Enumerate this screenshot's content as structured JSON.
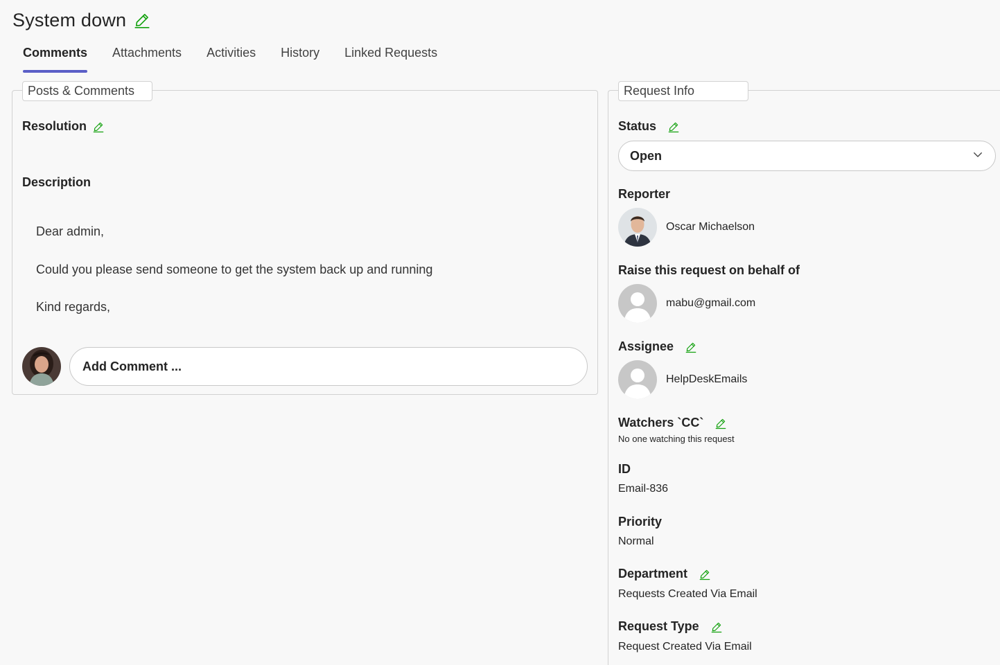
{
  "header": {
    "title": "System down"
  },
  "tabs": [
    {
      "label": "Comments",
      "active": true
    },
    {
      "label": "Attachments",
      "active": false
    },
    {
      "label": "Activities",
      "active": false
    },
    {
      "label": "History",
      "active": false
    },
    {
      "label": "Linked Requests",
      "active": false
    }
  ],
  "posts": {
    "legend": "Posts & Comments",
    "resolution_label": "Resolution",
    "description_label": "Description",
    "description_lines": [
      "Dear admin,",
      "Could you please send someone to get the system back up and running",
      "Kind regards,"
    ],
    "comment_placeholder": "Add Comment ..."
  },
  "request_info": {
    "legend": "Request Info",
    "status_label": "Status",
    "status_value": "Open",
    "reporter_label": "Reporter",
    "reporter_name": "Oscar Michaelson",
    "behalf_label": "Raise this request on behalf of",
    "behalf_value": "mabu@gmail.com",
    "assignee_label": "Assignee",
    "assignee_value": "HelpDeskEmails",
    "watchers_label": "Watchers `CC`",
    "watchers_value": "No one watching this request",
    "id_label": "ID",
    "id_value": "Email-836",
    "priority_label": "Priority",
    "priority_value": "Normal",
    "department_label": "Department",
    "department_value": "Requests Created Via Email",
    "request_type_label": "Request Type",
    "request_type_value": "Request Created Via Email"
  },
  "colors": {
    "accent": "#5b5fc7",
    "edit_icon": "#13a10e",
    "border": "#d1d1d1"
  },
  "icons": {
    "edit": "pencil-icon",
    "dropdown": "chevron-down-icon",
    "default_avatar": "person-placeholder-icon"
  }
}
